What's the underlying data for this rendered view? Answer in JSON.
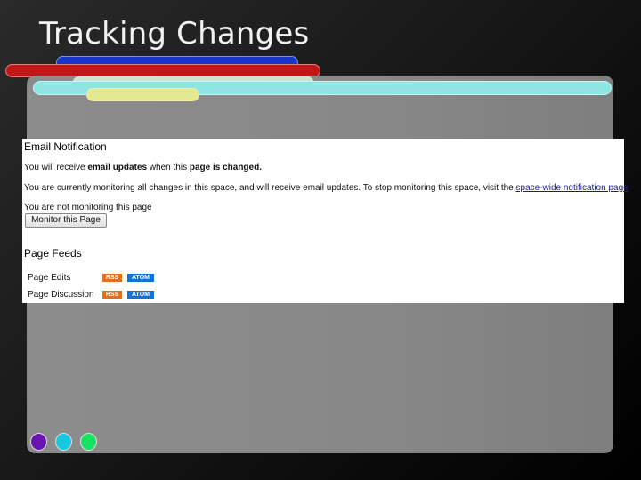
{
  "slide": {
    "title": "Tracking Changes"
  },
  "colors": {
    "bar_blue": "#1a33c8",
    "bar_red": "#c01818",
    "bar_cyan": "#8ee6e2",
    "bar_yellow": "#e4e890",
    "dot_purple": "#6a14b0",
    "dot_cyan": "#18c8e0",
    "dot_green": "#18e060"
  },
  "screenshot": {
    "email_heading": "Email Notification",
    "email_line_pre": "You will receive ",
    "email_line_b1": "email updates",
    "email_line_mid": " when this ",
    "email_line_b2": "page is changed.",
    "monitoring_text": "You are currently monitoring all changes in this space, and will receive email updates. To stop monitoring this space, visit the ",
    "monitoring_link": "space-wide notification page",
    "not_monitoring_text": "You are not monitoring this page",
    "monitor_button": "Monitor this Page",
    "feeds_heading": "Page Feeds",
    "feeds": [
      {
        "label": "Page Edits",
        "rss": "RSS",
        "atom": "ATOM"
      },
      {
        "label": "Page Discussion",
        "rss": "RSS",
        "atom": "ATOM"
      }
    ]
  }
}
